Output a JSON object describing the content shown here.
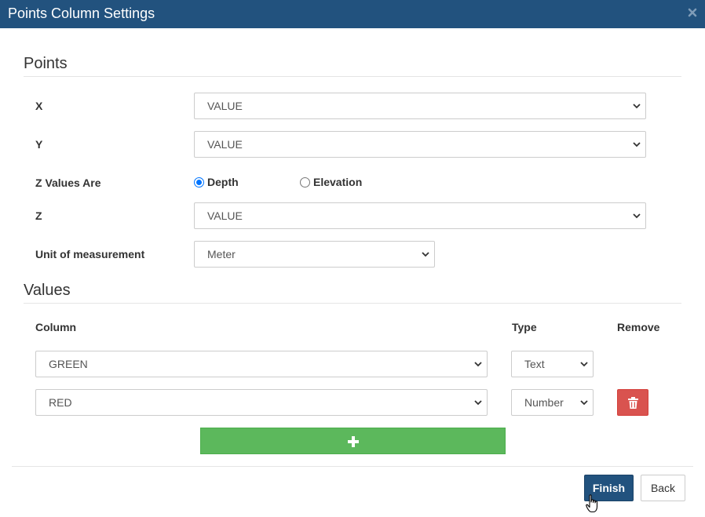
{
  "dialog": {
    "title": "Points Column Settings",
    "close_icon": "times-icon"
  },
  "points": {
    "heading": "Points",
    "x": {
      "label": "X",
      "value": "VALUE"
    },
    "y": {
      "label": "Y",
      "value": "VALUE"
    },
    "z_values_are": {
      "label": "Z Values Are",
      "options": [
        {
          "label": "Depth",
          "selected": true
        },
        {
          "label": "Elevation",
          "selected": false
        }
      ]
    },
    "z": {
      "label": "Z",
      "value": "VALUE"
    },
    "unit": {
      "label": "Unit of measurement",
      "value": "Meter"
    }
  },
  "values": {
    "heading": "Values",
    "headers": {
      "column": "Column",
      "type": "Type",
      "remove": "Remove"
    },
    "rows": [
      {
        "column": "GREEN",
        "type": "Text",
        "removable": false
      },
      {
        "column": "RED",
        "type": "Number",
        "removable": true
      }
    ],
    "add_icon": "plus-icon",
    "remove_icon": "trash-icon"
  },
  "footer": {
    "finish_label": "Finish",
    "back_label": "Back"
  },
  "colors": {
    "titlebar": "#22527e",
    "primary": "#22527e",
    "danger": "#d9534f",
    "success": "#5cb85c",
    "radio_accent": "#0075ff"
  }
}
